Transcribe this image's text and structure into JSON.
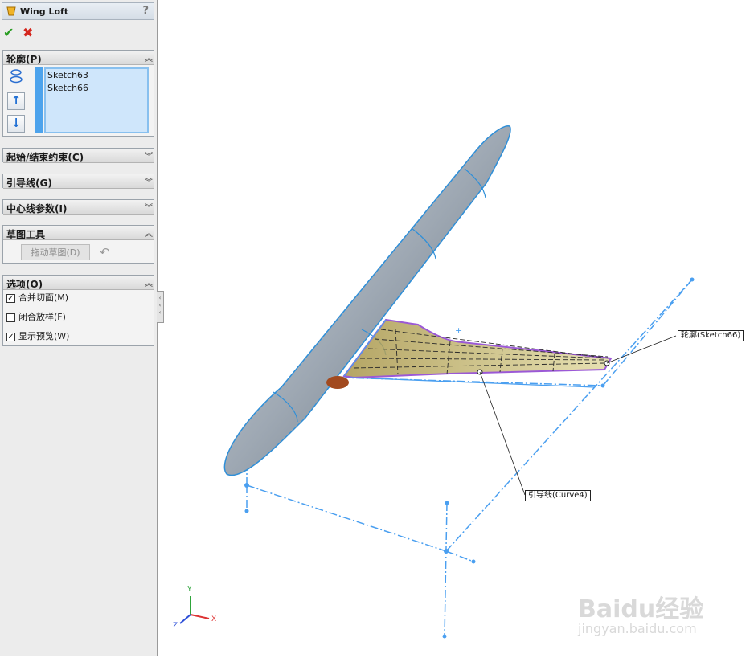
{
  "feature": {
    "title": "Wing Loft",
    "help": "?"
  },
  "actions": {
    "ok": "✔",
    "cancel": "✖"
  },
  "profiles": {
    "label": "轮廓(P)",
    "items": [
      "Sketch63",
      "Sketch66"
    ]
  },
  "groups": {
    "start_end": "起始/结束约束(C)",
    "guides": "引导线(G)",
    "centerline": "中心线参数(I)",
    "sketch_tools": "草图工具",
    "options": "选项(O)"
  },
  "sketch_tools": {
    "drag_button": "拖动草图(D)"
  },
  "options": {
    "items": [
      {
        "label": "合并切面(M)",
        "checked": true
      },
      {
        "label": "闭合放样(F)",
        "checked": false
      },
      {
        "label": "显示预览(W)",
        "checked": true
      }
    ]
  },
  "callouts": {
    "profile": "轮廓(Sketch66)",
    "guide": "引导线(Curve4)"
  },
  "triad": {
    "x": "X",
    "y": "Y",
    "z": "Z"
  },
  "watermark": {
    "brand": "Baidu经验",
    "url": "jingyan.baidu.com"
  },
  "colors": {
    "sketch": "#4a9ff0",
    "wing": "#9b59d6",
    "fuselage": "#9aa5b0"
  }
}
